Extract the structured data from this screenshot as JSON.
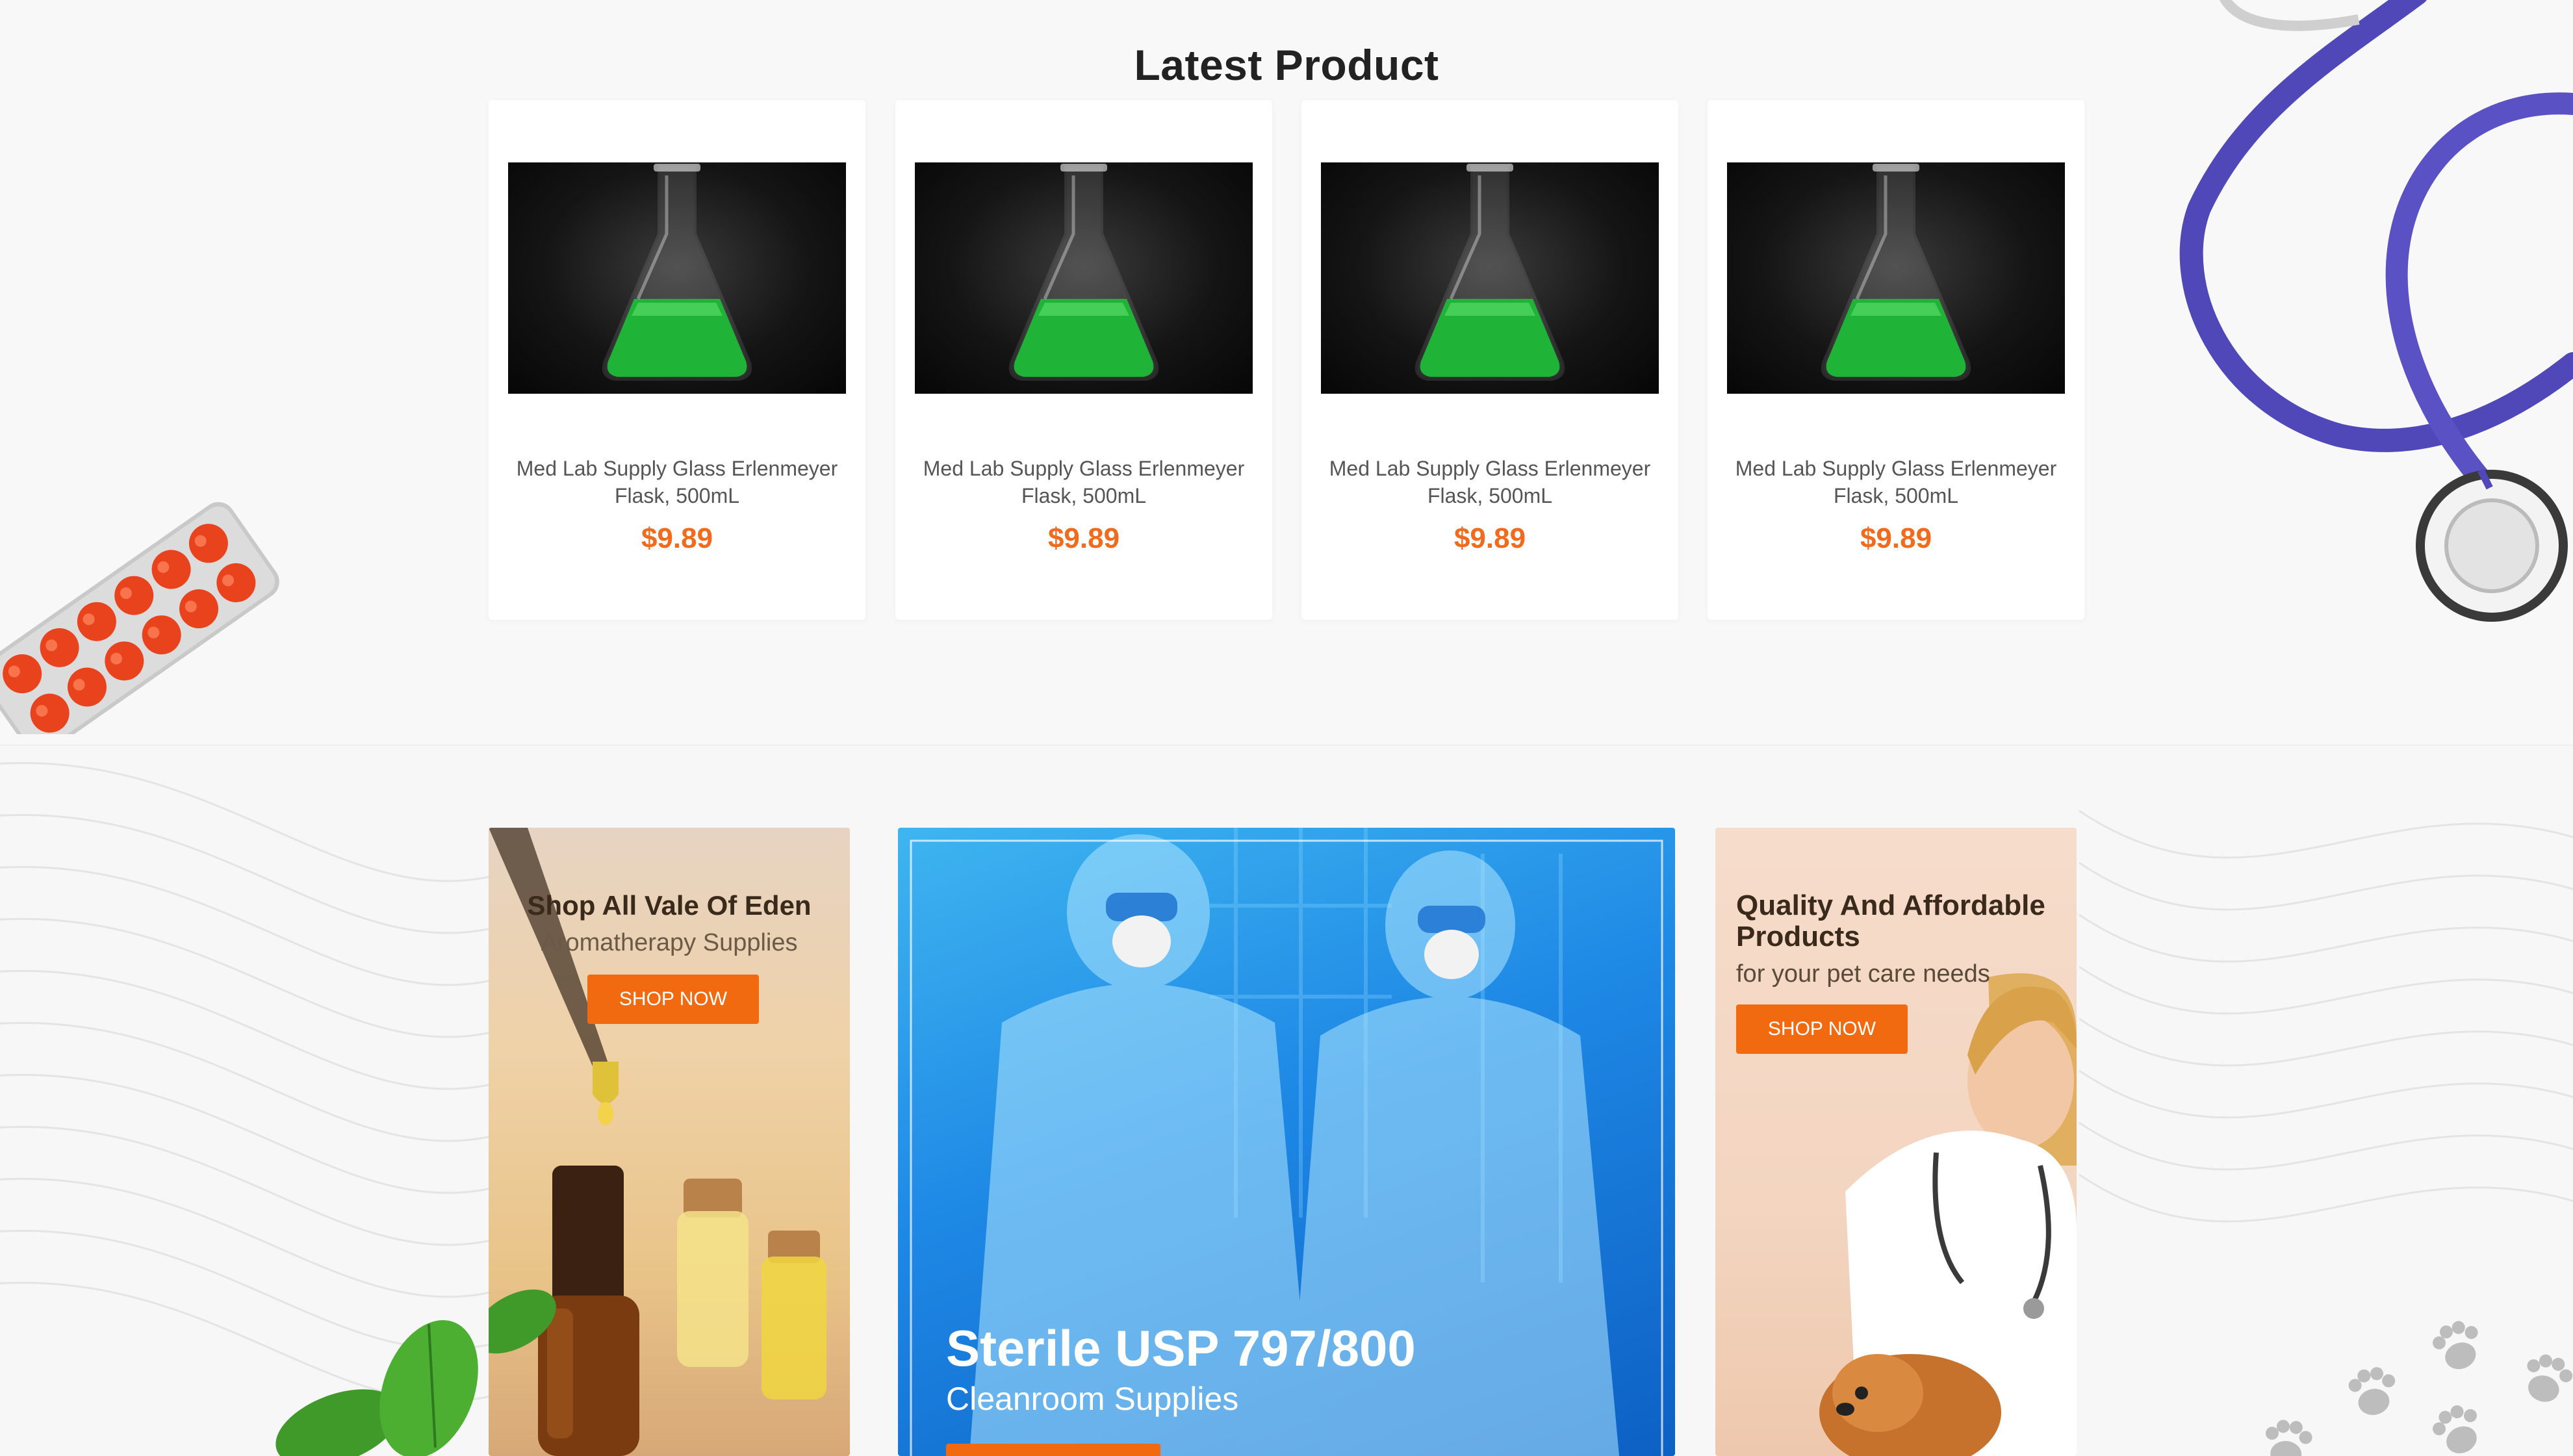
{
  "section": {
    "title": "Latest Product"
  },
  "products": [
    {
      "title": "Med Lab Supply Glass Erlenmeyer Flask, 500mL",
      "price": "$9.89"
    },
    {
      "title": "Med Lab Supply Glass Erlenmeyer Flask, 500mL",
      "price": "$9.89"
    },
    {
      "title": "Med Lab Supply Glass Erlenmeyer Flask, 500mL",
      "price": "$9.89"
    },
    {
      "title": "Med Lab Supply Glass Erlenmeyer Flask, 500mL",
      "price": "$9.89"
    }
  ],
  "banners": {
    "aromatherapy": {
      "title": "Shop All Vale Of Eden",
      "subtitle": "Aromatherapy Supplies",
      "button": "SHOP NOW"
    },
    "cleanroom": {
      "title": "Sterile USP 797/800",
      "subtitle": "Cleanroom Supplies"
    },
    "petcare": {
      "title": "Quality And Affordable Products",
      "subtitle": "for your pet care needs",
      "button": "SHOP NOW"
    }
  },
  "colors": {
    "accent": "#f26a10",
    "price": "#f26b1d",
    "heading": "#222222",
    "banner_blue": "#1e88e5",
    "stethoscope": "#5048b8"
  },
  "icons": [
    "pill-blister-icon",
    "stethoscope-icon",
    "erlenmeyer-flask-icon",
    "paw-print-icon",
    "basil-leaf-icon"
  ]
}
